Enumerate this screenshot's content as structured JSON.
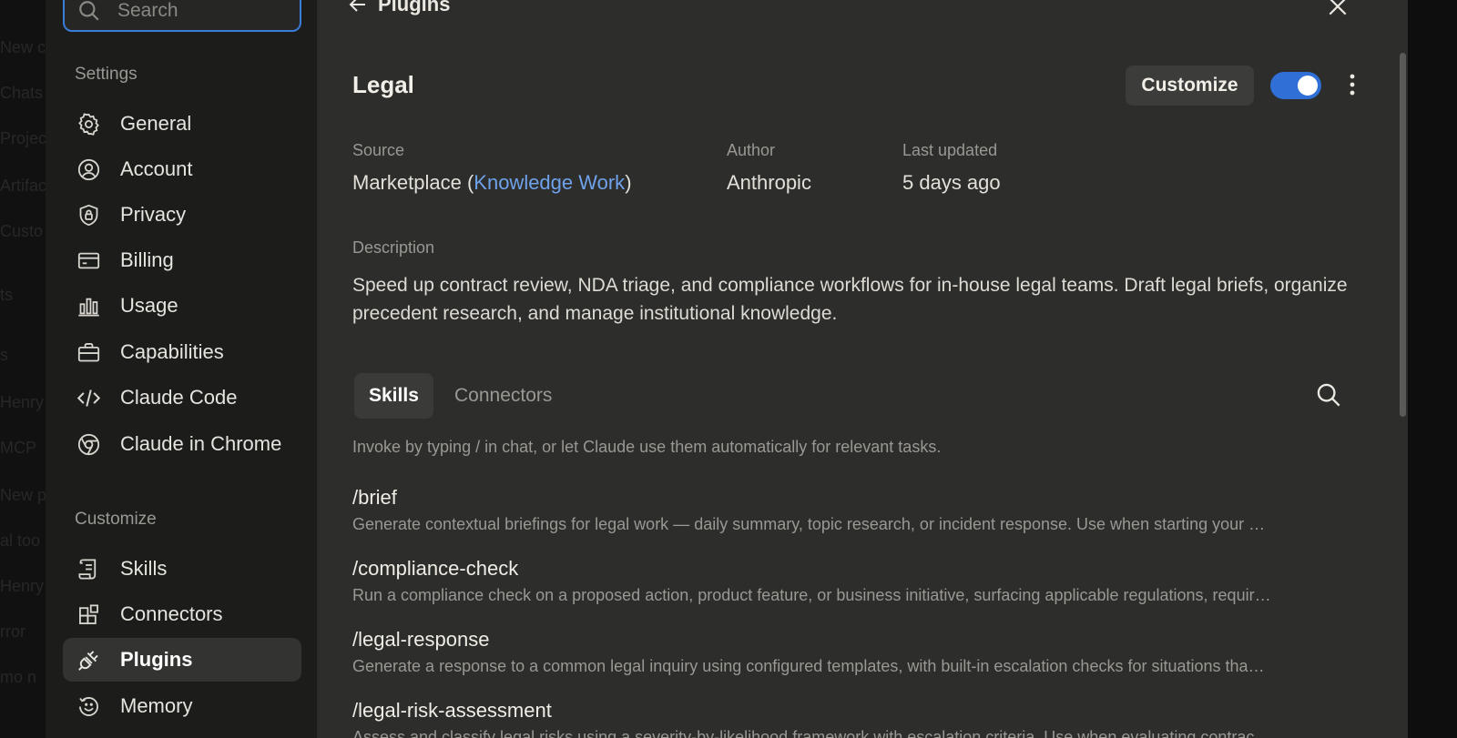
{
  "background": {
    "ghost_items": [
      "New c",
      "Chats",
      "Projec",
      "Artifac",
      "Custo",
      "ts",
      "s",
      "Henry",
      "MCP",
      "New p",
      "al too",
      "Henry",
      "rror",
      "mo n"
    ]
  },
  "sidebar": {
    "search_placeholder": "Search",
    "section_settings": "Settings",
    "settings_items": [
      {
        "label": "General",
        "icon": "gear-icon"
      },
      {
        "label": "Account",
        "icon": "user-circle-icon"
      },
      {
        "label": "Privacy",
        "icon": "shield-lock-icon"
      },
      {
        "label": "Billing",
        "icon": "credit-card-icon"
      },
      {
        "label": "Usage",
        "icon": "bar-chart-icon"
      },
      {
        "label": "Capabilities",
        "icon": "briefcase-icon"
      },
      {
        "label": "Claude Code",
        "icon": "code-icon"
      },
      {
        "label": "Claude in Chrome",
        "icon": "globe-icon"
      }
    ],
    "section_customize": "Customize",
    "customize_items": [
      {
        "label": "Skills",
        "icon": "scroll-icon"
      },
      {
        "label": "Connectors",
        "icon": "blocks-icon"
      },
      {
        "label": "Plugins",
        "icon": "plug-icon",
        "active": true
      },
      {
        "label": "Memory",
        "icon": "memory-icon"
      }
    ]
  },
  "header": {
    "back_label": "Plugins"
  },
  "plugin": {
    "name": "Legal",
    "customize_label": "Customize",
    "enabled": true,
    "source_label": "Source",
    "source_prefix": "Marketplace (",
    "source_link": "Knowledge Work",
    "source_suffix": ")",
    "author_label": "Author",
    "author": "Anthropic",
    "updated_label": "Last updated",
    "updated": "5 days ago",
    "description_label": "Description",
    "description": "Speed up contract review, NDA triage, and compliance workflows for in-house legal teams. Draft legal briefs, organize precedent research, and manage institutional knowledge."
  },
  "tabs": {
    "skills": "Skills",
    "connectors": "Connectors",
    "hint": "Invoke by typing / in chat, or let Claude use them automatically for relevant tasks."
  },
  "skills": [
    {
      "name": "/brief",
      "desc": "Generate contextual briefings for legal work — daily summary, topic research, or incident response. Use when starting your …"
    },
    {
      "name": "/compliance-check",
      "desc": "Run a compliance check on a proposed action, product feature, or business initiative, surfacing applicable regulations, requir…"
    },
    {
      "name": "/legal-response",
      "desc": "Generate a response to a common legal inquiry using configured templates, with built-in escalation checks for situations tha…"
    },
    {
      "name": "/legal-risk-assessment",
      "desc": "Assess and classify legal risks using a severity-by-likelihood framework with escalation criteria. Use when evaluating contrac…"
    }
  ],
  "colors": {
    "accent": "#3b7bd9",
    "toggle": "#2f6fd6",
    "link": "#6ea2ea"
  }
}
